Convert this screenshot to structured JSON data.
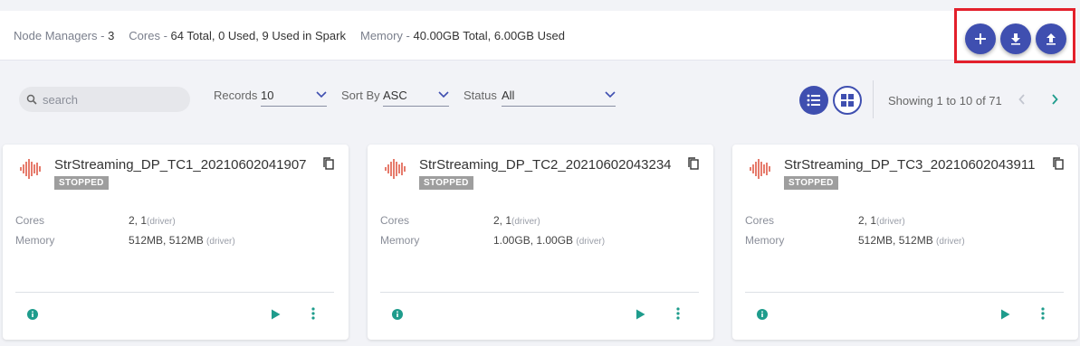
{
  "summary": {
    "node_managers_label": "Node Managers",
    "node_managers_value": "3",
    "cores_label": "Cores",
    "cores_value": "64 Total, 0 Used, 9 Used in Spark",
    "memory_label": "Memory",
    "memory_value": "40.00GB Total, 6.00GB Used",
    "separator": " - "
  },
  "actions": {
    "add_icon": "plus-icon",
    "download_icon": "download-icon",
    "upload_icon": "upload-icon",
    "highlight_color": "#e3202b",
    "button_color": "#3f4fb0"
  },
  "filters": {
    "search_placeholder": "search",
    "records_label": "Records",
    "records_value": "10",
    "sortby_label": "Sort By",
    "sortby_value": "ASC",
    "status_label": "Status",
    "status_value": "All"
  },
  "pagination": {
    "showing_text": "Showing 1 to 10 of 71"
  },
  "cards": [
    {
      "name": "StrStreaming_DP_TC1_20210602041907",
      "status": "STOPPED",
      "cores_label": "Cores",
      "cores_value": "2, 1",
      "cores_sub": "(driver)",
      "memory_label": "Memory",
      "memory_value": "512MB, 512MB ",
      "memory_sub": "(driver)"
    },
    {
      "name": "StrStreaming_DP_TC2_20210602043234",
      "status": "STOPPED",
      "cores_label": "Cores",
      "cores_value": "2, 1",
      "cores_sub": "(driver)",
      "memory_label": "Memory",
      "memory_value": "1.00GB, 1.00GB ",
      "memory_sub": "(driver)"
    },
    {
      "name": "StrStreaming_DP_TC3_20210602043911",
      "status": "STOPPED",
      "cores_label": "Cores",
      "cores_value": "2, 1",
      "cores_sub": "(driver)",
      "memory_label": "Memory",
      "memory_value": "512MB, 512MB ",
      "memory_sub": "(driver)"
    }
  ]
}
